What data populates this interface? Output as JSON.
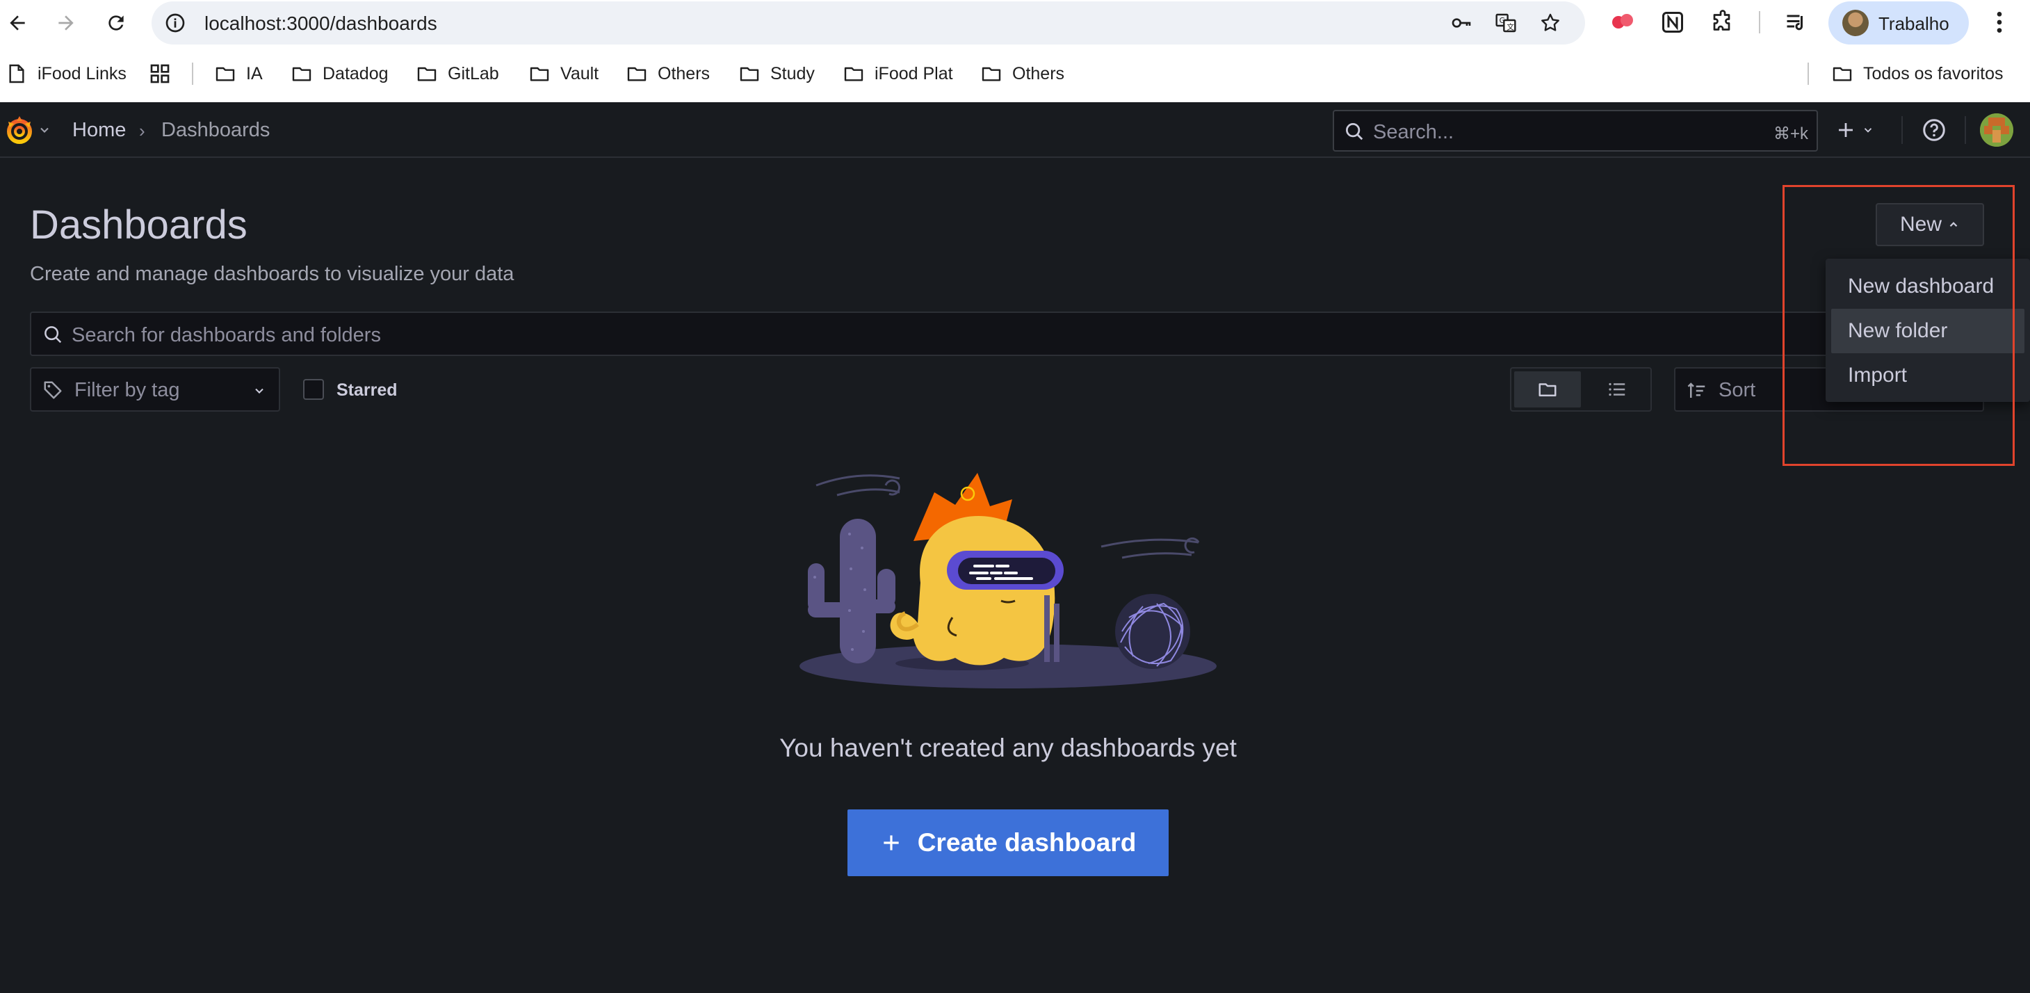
{
  "browser": {
    "url": "localhost:3000/dashboards",
    "profile_name": "Trabalho",
    "bookmarks": [
      "iFood Links",
      "IA",
      "Datadog",
      "GitLab",
      "Vault",
      "Others",
      "Study",
      "iFood Plat",
      "Others"
    ],
    "all_bookmarks": "Todos os favoritos"
  },
  "topbar": {
    "breadcrumb_home": "Home",
    "breadcrumb_sep": "›",
    "breadcrumb_current": "Dashboards",
    "search_placeholder": "Search...",
    "search_shortcut": "⌘+k"
  },
  "page": {
    "title": "Dashboards",
    "subtitle": "Create and manage dashboards to visualize your data",
    "new_button": "New",
    "search_placeholder": "Search for dashboards and folders",
    "tag_filter_placeholder": "Filter by tag",
    "starred_label": "Starred",
    "sort_placeholder": "Sort"
  },
  "new_menu": {
    "items": [
      "New dashboard",
      "New folder",
      "Import"
    ],
    "hovered": "New folder"
  },
  "empty_state": {
    "message": "You haven't created any dashboards yet",
    "create_button": "Create dashboard"
  },
  "colors": {
    "background": "#181b1f",
    "primary_button": "#3d71d9",
    "highlight": "#e0432c",
    "grafana_orange": "#f46800"
  }
}
